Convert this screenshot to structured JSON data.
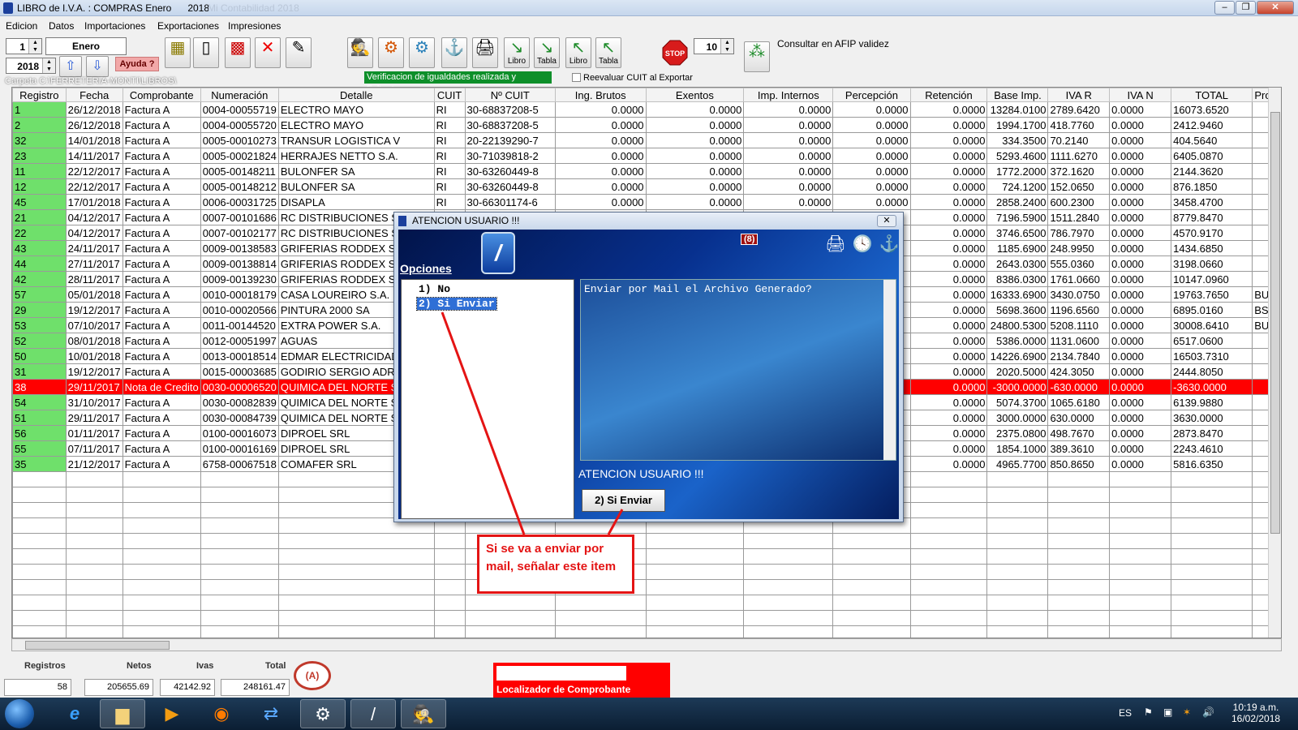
{
  "window": {
    "title": "LIBRO de I.V.A. : COMPRAS Enero",
    "year_tab": "2018",
    "ghost": "Mi Contabilidad 2018"
  },
  "menu": [
    "Edicion",
    "Datos",
    "Importaciones",
    "Exportaciones",
    "Impresiones"
  ],
  "toolbar": {
    "month_num": "1",
    "month_name": "Enero",
    "year": "2018",
    "help": "Ayuda ?",
    "libro1": "Libro",
    "tabla1": "Tabla",
    "libro2": "Libro",
    "tabla2": "Tabla",
    "count": "10",
    "afip": "Consultar en AFIP validez",
    "verif": "Verificacion de igualdades realizada y Faltantes",
    "reeval": "Reevaluar CUIT al Exportar",
    "carpeta": "Carpeta C:\\FERRETERIA-MONTI\\LIBROS\\"
  },
  "columns": [
    "Registro",
    "Fecha",
    "Comprobante",
    "Numeración",
    "Detalle",
    "CUIT",
    "Nº CUIT",
    "Ing. Brutos",
    "Exentos",
    "Imp. Internos",
    "Percepción",
    "Retención",
    "Base Imp.",
    "IVA R",
    "IVA N",
    "TOTAL",
    "Provi"
  ],
  "rows": [
    [
      "1",
      "26/12/2018",
      "Factura A",
      "0004-00055719",
      "ELECTRO  MAYO",
      "RI",
      "30-68837208-5",
      "0.0000",
      "0.0000",
      "0.0000",
      "0.0000",
      "0.0000",
      "13284.0100",
      "2789.6420",
      "0.0000",
      "16073.6520",
      ""
    ],
    [
      "2",
      "26/12/2018",
      "Factura A",
      "0004-00055720",
      "ELECTRO  MAYO",
      "RI",
      "30-68837208-5",
      "0.0000",
      "0.0000",
      "0.0000",
      "0.0000",
      "0.0000",
      "1994.1700",
      "418.7760",
      "0.0000",
      "2412.9460",
      ""
    ],
    [
      "32",
      "14/01/2018",
      "Factura A",
      "0005-00010273",
      "TRANSUR LOGISTICA  V",
      "RI",
      "20-22139290-7",
      "0.0000",
      "0.0000",
      "0.0000",
      "0.0000",
      "0.0000",
      "334.3500",
      "70.2140",
      "0.0000",
      "404.5640",
      ""
    ],
    [
      "23",
      "14/11/2017",
      "Factura A",
      "0005-00021824",
      "HERRAJES NETTO S.A.",
      "RI",
      "30-71039818-2",
      "0.0000",
      "0.0000",
      "0.0000",
      "0.0000",
      "0.0000",
      "5293.4600",
      "1111.6270",
      "0.0000",
      "6405.0870",
      ""
    ],
    [
      "11",
      "22/12/2017",
      "Factura A",
      "0005-00148211",
      "BULONFER SA",
      "RI",
      "30-63260449-8",
      "0.0000",
      "0.0000",
      "0.0000",
      "0.0000",
      "0.0000",
      "1772.2000",
      "372.1620",
      "0.0000",
      "2144.3620",
      ""
    ],
    [
      "12",
      "22/12/2017",
      "Factura A",
      "0005-00148212",
      "BULONFER SA",
      "RI",
      "30-63260449-8",
      "0.0000",
      "0.0000",
      "0.0000",
      "0.0000",
      "0.0000",
      "724.1200",
      "152.0650",
      "0.0000",
      "876.1850",
      ""
    ],
    [
      "45",
      "17/01/2018",
      "Factura A",
      "0006-00031725",
      "DISAPLA",
      "RI",
      "30-66301174-6",
      "0.0000",
      "0.0000",
      "0.0000",
      "0.0000",
      "0.0000",
      "2858.2400",
      "600.2300",
      "0.0000",
      "3458.4700",
      ""
    ],
    [
      "21",
      "04/12/2017",
      "Factura A",
      "0007-00101686",
      "RC DISTRIBUCIONES S",
      "",
      "",
      "",
      "",
      "",
      "",
      "0.0000",
      "7196.5900",
      "1511.2840",
      "0.0000",
      "8779.8470",
      ""
    ],
    [
      "22",
      "04/12/2017",
      "Factura A",
      "0007-00102177",
      "RC DISTRIBUCIONES S",
      "",
      "",
      "",
      "",
      "",
      "",
      "0.0000",
      "3746.6500",
      "786.7970",
      "0.0000",
      "4570.9170",
      ""
    ],
    [
      "43",
      "24/11/2017",
      "Factura A",
      "0009-00138583",
      "GRIFERIAS RODDEX SA",
      "",
      "",
      "",
      "",
      "",
      "",
      "0.0000",
      "1185.6900",
      "248.9950",
      "0.0000",
      "1434.6850",
      ""
    ],
    [
      "44",
      "27/11/2017",
      "Factura A",
      "0009-00138814",
      "GRIFERIAS RODDEX SA",
      "",
      "",
      "",
      "",
      "",
      "",
      "0.0000",
      "2643.0300",
      "555.0360",
      "0.0000",
      "3198.0660",
      ""
    ],
    [
      "42",
      "28/11/2017",
      "Factura A",
      "0009-00139230",
      "GRIFERIAS RODDEX SA",
      "",
      "",
      "",
      "",
      "",
      "",
      "0.0000",
      "8386.0300",
      "1761.0660",
      "0.0000",
      "10147.0960",
      ""
    ],
    [
      "57",
      "05/01/2018",
      "Factura A",
      "0010-00018179",
      "CASA LOUREIRO S.A.",
      "",
      "",
      "",
      "",
      "",
      "",
      "0.0000",
      "16333.6900",
      "3430.0750",
      "0.0000",
      "19763.7650",
      "BUE"
    ],
    [
      "29",
      "19/12/2017",
      "Factura A",
      "0010-00020566",
      "PINTURA 2000 SA",
      "",
      "",
      "",
      "",
      "",
      "",
      "0.0000",
      "5698.3600",
      "1196.6560",
      "0.0000",
      "6895.0160",
      "BS A"
    ],
    [
      "53",
      "07/10/2017",
      "Factura A",
      "0011-00144520",
      "EXTRA POWER S.A.",
      "",
      "",
      "",
      "",
      "",
      "",
      "0.0000",
      "24800.5300",
      "5208.1110",
      "0.0000",
      "30008.6410",
      "BUE"
    ],
    [
      "52",
      "08/01/2018",
      "Factura A",
      "0012-00051997",
      "AGUAS",
      "",
      "",
      "",
      "",
      "",
      "",
      "0.0000",
      "5386.0000",
      "1131.0600",
      "0.0000",
      "6517.0600",
      ""
    ],
    [
      "50",
      "10/01/2018",
      "Factura A",
      "0013-00018514",
      "EDMAR ELECTRICIDAD",
      "",
      "",
      "",
      "",
      "",
      "",
      "0.0000",
      "14226.6900",
      "2134.7840",
      "0.0000",
      "16503.7310",
      ""
    ],
    [
      "31",
      "19/12/2017",
      "Factura A",
      "0015-00003685",
      "GODIRIO SERGIO ADRI",
      "",
      "",
      "",
      "",
      "",
      "",
      "0.0000",
      "2020.5000",
      "424.3050",
      "0.0000",
      "2444.8050",
      ""
    ],
    [
      "38",
      "29/11/2017",
      "Nota de Credito",
      "0030-00006520",
      "QUIMICA DEL NORTE S",
      "",
      "",
      "",
      "",
      "",
      "",
      "0.0000",
      "-3000.0000",
      "-630.0000",
      "0.0000",
      "-3630.0000",
      ""
    ],
    [
      "54",
      "31/10/2017",
      "Factura A",
      "0030-00082839",
      "QUIMICA DEL NORTE S",
      "",
      "",
      "",
      "",
      "",
      "",
      "0.0000",
      "5074.3700",
      "1065.6180",
      "0.0000",
      "6139.9880",
      ""
    ],
    [
      "51",
      "29/11/2017",
      "Factura A",
      "0030-00084739",
      "QUIMICA DEL NORTE S",
      "",
      "",
      "",
      "",
      "",
      "",
      "0.0000",
      "3000.0000",
      "630.0000",
      "0.0000",
      "3630.0000",
      ""
    ],
    [
      "56",
      "01/11/2017",
      "Factura A",
      "0100-00016073",
      "DIPROEL SRL",
      "",
      "",
      "",
      "",
      "",
      "",
      "0.0000",
      "2375.0800",
      "498.7670",
      "0.0000",
      "2873.8470",
      ""
    ],
    [
      "55",
      "07/11/2017",
      "Factura A",
      "0100-00016169",
      "DIPROEL SRL",
      "",
      "",
      "",
      "",
      "",
      "",
      "0.0000",
      "1854.1000",
      "389.3610",
      "0.0000",
      "2243.4610",
      ""
    ],
    [
      "35",
      "21/12/2017",
      "Factura A",
      "6758-00067518",
      "COMAFER SRL",
      "",
      "",
      "",
      "",
      "",
      "",
      "0.0000",
      "4965.7700",
      "850.8650",
      "0.0000",
      "5816.6350",
      ""
    ]
  ],
  "dialog": {
    "title": "ATENCION USUARIO !!!",
    "badge": "(8)",
    "opciones": "Opciones",
    "opt1": "1) No",
    "opt2": "2) Si Enviar",
    "message": "Enviar por Mail el Archivo Generado?",
    "attention": "ATENCION USUARIO !!!",
    "button": "2) Si Enviar"
  },
  "callout": "Si se va a enviar por mail, señalar este item",
  "footer": {
    "registros_label": "Registros",
    "registros": "58",
    "netos_label": "Netos",
    "netos": "205655.69",
    "ivas_label": "Ivas",
    "ivas": "42142.92",
    "total_label": "Total",
    "total": "248161.47",
    "localizador": "Localizador de Comprobante"
  },
  "taskbar": {
    "lang": "ES",
    "time": "10:19 a.m.",
    "date": "16/02/2018"
  },
  "colors": {
    "green_cell": "#6fe06b",
    "highlight_row": "#ff0000",
    "callout": "#e41414"
  },
  "highlight_row_index": 18
}
